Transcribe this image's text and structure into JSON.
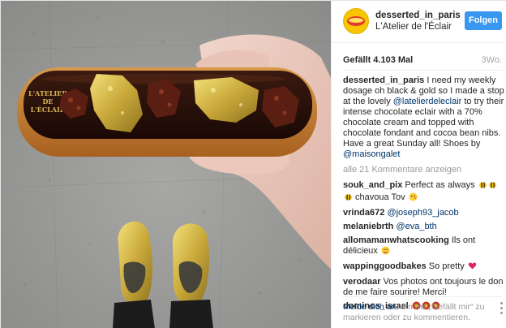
{
  "post": {
    "username": "desserted_in_paris",
    "location": "L'Atelier de l'Éclair",
    "follow_label": "Folgen",
    "likes": "Gefällt 4.103 Mal",
    "time_ago": "3Wo.",
    "photo_logo_lines": [
      "L'ATELIER",
      "DE",
      "L'ÉCLAIR"
    ]
  },
  "caption": {
    "user": "desserted_in_paris",
    "text1": " I need my weekly dosage oh black & gold so I made a stop at the lovely ",
    "mention1": "@latelierdeleclair",
    "text2": " to try their intense chocolate eclair with a 70% chocolate cream and topped with chocolate fondant and cocoa bean nibs. Have a great Sunday all! Shoes by ",
    "mention2": "@maisongalet"
  },
  "view_all": "alle 21 Kommentare anzeigen",
  "comments": [
    {
      "user": "souk_and_pix",
      "text": " Perfect as always ",
      "suffix": " chavoua Tov "
    },
    {
      "user": "vrinda672",
      "text": " ",
      "mention": "@joseph93_jacob"
    },
    {
      "user": "melaniebrth",
      "text": " ",
      "mention": "@eva_bth"
    },
    {
      "user": "allomamanwhatscooking",
      "text": " Ils ont délicieux "
    },
    {
      "user": "wappinggoodbakes",
      "text": " So pretty "
    },
    {
      "user": "verodaar",
      "text": " Vos photos ont toujours le don de me faire sourire! Merci!"
    },
    {
      "user": "dominos_israel",
      "text": " "
    }
  ],
  "footer": {
    "login_link": "Melde dich an",
    "rest": ", um mit „Gefällt mir“ zu markieren oder zu kommentieren."
  },
  "colors": {
    "follow_button": "#3897f0",
    "mention": "#003569",
    "muted": "#999999"
  },
  "icons": [
    "bee-emoji",
    "kiss-emoji",
    "yum-emoji",
    "heart-emoji",
    "flower-emoji",
    "more-dots-icon"
  ]
}
